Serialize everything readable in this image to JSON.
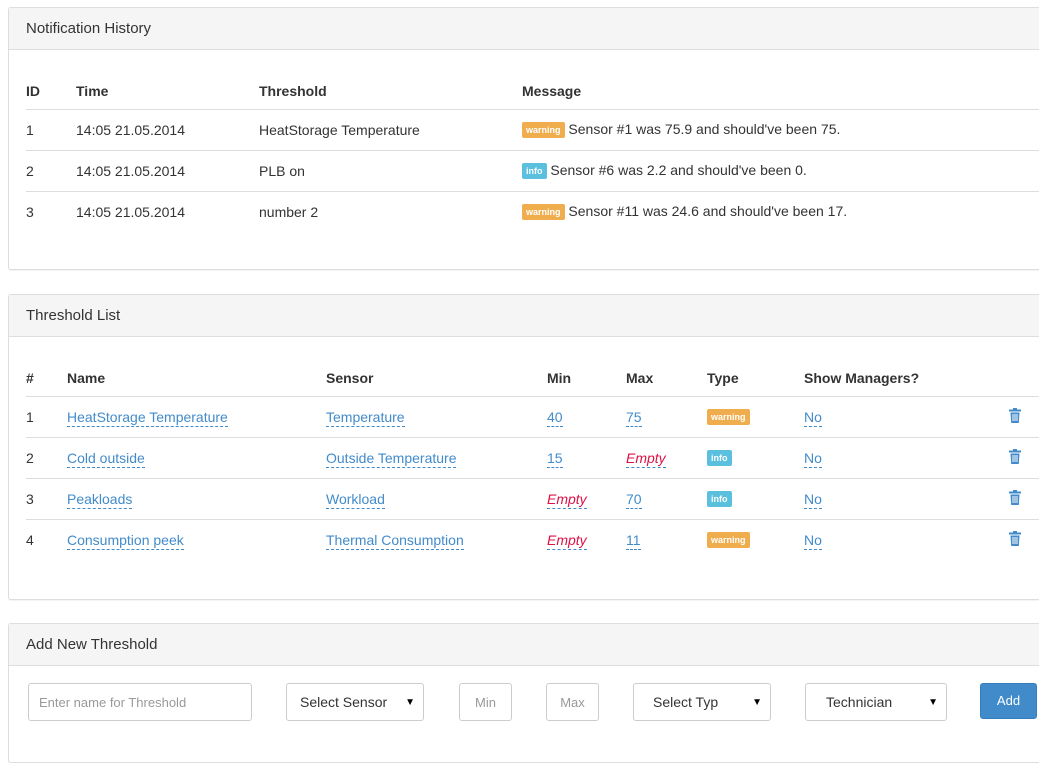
{
  "notification_history": {
    "title": "Notification History",
    "headers": {
      "id": "ID",
      "time": "Time",
      "threshold": "Threshold",
      "message": "Message"
    },
    "rows": [
      {
        "id": "1",
        "time": "14:05 21.05.2014",
        "threshold": "HeatStorage Temperature",
        "level": "warning",
        "message": "Sensor #1 was 75.9 and should've been 75."
      },
      {
        "id": "2",
        "time": "14:05 21.05.2014",
        "threshold": "PLB on",
        "level": "info",
        "message": "Sensor #6 was 2.2 and should've been 0."
      },
      {
        "id": "3",
        "time": "14:05 21.05.2014",
        "threshold": "number 2",
        "level": "warning",
        "message": "Sensor #11 was 24.6 and should've been 17."
      }
    ]
  },
  "threshold_list": {
    "title": "Threshold List",
    "headers": {
      "num": "#",
      "name": "Name",
      "sensor": "Sensor",
      "min": "Min",
      "max": "Max",
      "type": "Type",
      "show_managers": "Show Managers?"
    },
    "rows": [
      {
        "num": "1",
        "name": "HeatStorage Temperature",
        "sensor": "Temperature",
        "min": "40",
        "max": "75",
        "type": "warning",
        "show_managers": "No"
      },
      {
        "num": "2",
        "name": "Cold outside",
        "sensor": "Outside Temperature",
        "min": "15",
        "max": "Empty",
        "type": "info",
        "show_managers": "No"
      },
      {
        "num": "3",
        "name": "Peakloads",
        "sensor": "Workload",
        "min": "Empty",
        "max": "70",
        "type": "info",
        "show_managers": "No"
      },
      {
        "num": "4",
        "name": "Consumption peek",
        "sensor": "Thermal Consumption",
        "min": "Empty",
        "max": "11",
        "type": "warning",
        "show_managers": "No"
      }
    ]
  },
  "add_threshold": {
    "title": "Add New Threshold",
    "name_placeholder": "Enter name for Threshold",
    "sensor_select": "Select Sensor",
    "min_placeholder": "Min",
    "max_placeholder": "Max",
    "type_select": "Select Typ",
    "role_select": "Technician",
    "add_label": "Add"
  },
  "colors": {
    "warning": "#f0ad4e",
    "info": "#5bc0de",
    "link": "#428bca",
    "empty": "#dd1144",
    "primary": "#428bca"
  },
  "icons": {
    "delete": "trash-icon",
    "dropdown": "caret-down-icon"
  }
}
